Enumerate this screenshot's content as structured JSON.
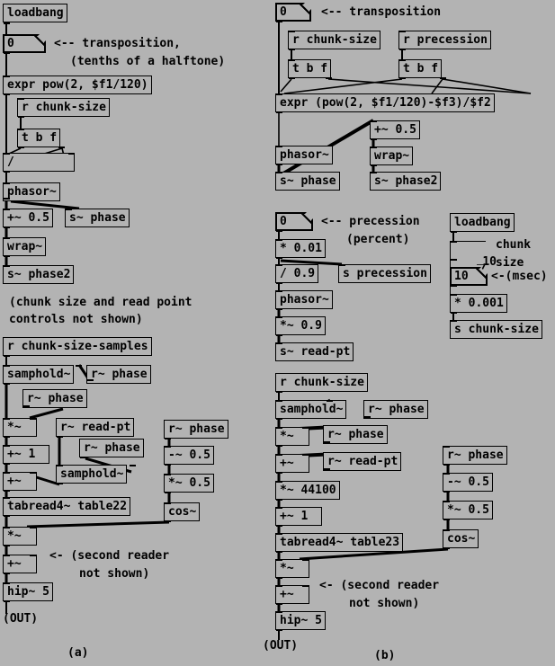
{
  "document": {
    "kind": "pure-data-patch",
    "background_color": "#b3b3b3",
    "ink_color": "#000000",
    "figure_labels": {
      "left": "(a)",
      "right": "(b)"
    }
  },
  "panel_a": {
    "objects": {
      "loadbang": "loadbang",
      "transposition_number": "0",
      "expr_transpose": "expr pow(2, $f1/120)",
      "r_chunk_size": "r chunk-size",
      "t_b_f": "t b f",
      "divide": "/",
      "phasor": "phasor~",
      "plus_half": "+~ 0.5",
      "s_phase": "s~ phase",
      "wrap": "wrap~",
      "s_phase2": "s~ phase2",
      "r_chunk_size_samples": "r chunk-size-samples",
      "samphold_a": "samphold~",
      "r_phase_1": "r~ phase",
      "r_phase_2": "r~ phase",
      "times_sig": "*~",
      "plus_one": "+~ 1",
      "plus_sig": "+~",
      "r_read_pt": "r~ read-pt",
      "r_phase_3": "r~ phase",
      "samphold_b": "samphold~",
      "tabread4": "tabread4~ table22",
      "r_phase_4": "r~ phase",
      "minus_half": "-~ 0.5",
      "times_half": "*~ 0.5",
      "cos": "cos~",
      "times_sig2": "*~",
      "plus_sig2": "+~",
      "hip": "hip~ 5"
    },
    "comments": {
      "transposition_line1": "<-- transposition,",
      "transposition_line2": "(tenths of a halftone)",
      "not_shown_line1": "(chunk size and read point",
      "not_shown_line2": "controls not shown)",
      "second_reader_line1": "<- (second reader",
      "second_reader_line2": "not shown)",
      "out": "(OUT)"
    }
  },
  "panel_b": {
    "objects": {
      "transposition_number": "0",
      "r_chunk_size": "r chunk-size",
      "r_precession": "r precession",
      "t_b_f_left": "t b f",
      "t_b_f_right": "t b f",
      "expr_main": "expr (pow(2, $f1/120)-$f3)/$f2",
      "phasor": "phasor~",
      "s_phase": "s~ phase",
      "plus_half": "+~ 0.5",
      "wrap": "wrap~",
      "s_phase2": "s~ phase2",
      "precession_number": "0",
      "times_point01": "* 0.01",
      "divide_point9": "/ 0.9",
      "s_precession": "s precession",
      "phasor2": "phasor~",
      "times_sig_point9": "*~ 0.9",
      "s_read_pt": "s~ read-pt",
      "loadbang": "loadbang",
      "msg_ten": "10",
      "num_ten": "10",
      "times_point001": "* 0.001",
      "s_chunk_size": "s chunk-size",
      "r_chunk_size2": "r chunk-size",
      "samphold_a": "samphold~",
      "r_phase_1": "r~ phase",
      "times_sig": "*~",
      "r_phase_2": "r~ phase",
      "plus_sig": "+~",
      "r_read_pt": "r~ read-pt",
      "times_44100": "*~ 44100",
      "plus_one": "+~ 1",
      "tabread4": "tabread4~ table23",
      "r_phase_3": "r~ phase",
      "minus_half": "-~ 0.5",
      "times_half": "*~ 0.5",
      "cos": "cos~",
      "times_sig2": "*~",
      "plus_sig2": "+~",
      "hip": "hip~ 5"
    },
    "comments": {
      "transposition": "<-- transposition",
      "precession_line1": "<-- precession",
      "precession_line2": "(percent)",
      "chunk_line1": "chunk",
      "chunk_line2": "size",
      "msec": "<-(msec)",
      "second_reader_line1": "<- (second reader",
      "second_reader_line2": "not shown)",
      "out": "(OUT)"
    }
  }
}
